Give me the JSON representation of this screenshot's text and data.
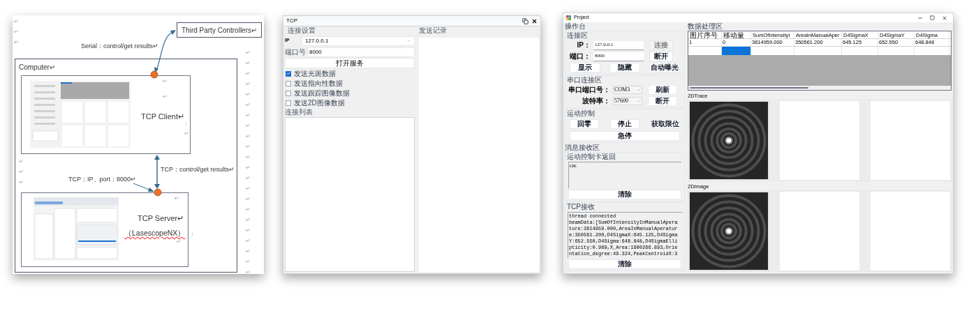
{
  "diagram": {
    "third_party": "Third Party Controllers↵",
    "serial_label": "Serial：control/get results↵",
    "computer_label": "Computer↵",
    "client_label": "TCP Client↵",
    "tcp_results_label": "TCP：control/get results↵",
    "tcp_port_label": "TCP：IP、port：8000↵",
    "server_label": "TCP Server↵",
    "server_name": "（LasescopeNX）",
    "server_name_mark": "↓",
    "left_marks": [
      "↵",
      "↵",
      "↵",
      "↵",
      "↵",
      "↵"
    ],
    "margin_marks": [
      "↵",
      "↵",
      "↵",
      "↵",
      "↵",
      "↵",
      "↵",
      "↵",
      "↵",
      "↵",
      "↵",
      "↵",
      "↵",
      "↵",
      "↵",
      "↵",
      "↵",
      "↵",
      "↵",
      "↵",
      "↵",
      "↵"
    ],
    "client_marks": [
      "↵",
      "↵",
      "↓",
      "↵"
    ],
    "server_marks": [
      "↵",
      "↵"
    ]
  },
  "tcp_window": {
    "title": "TCP",
    "settings_label": "连接设置",
    "ip_label": "IP",
    "ip_value": "127.0.0.1",
    "port_label": "端口号",
    "port_value": "8000",
    "open_button": "打开服务",
    "checkboxes": [
      {
        "label": "发送光斑数据",
        "checked": true
      },
      {
        "label": "发送指向性数据",
        "checked": false
      },
      {
        "label": "发送跟踪图像数据",
        "checked": false
      },
      {
        "label": "发送2D图像数据",
        "checked": false
      }
    ],
    "list_label": "连接列表",
    "log_label": "发送记录"
  },
  "project_window": {
    "title": "Project",
    "console_label": "操作台",
    "connect_group": "连接区",
    "connect_rows": [
      {
        "label": "IP：",
        "value": "127.0.0.1",
        "button": {
          "label": "连接",
          "disabled": true
        }
      },
      {
        "label": "端口：",
        "value": "8000",
        "button": {
          "label": "断开",
          "disabled": false
        }
      }
    ],
    "view_buttons": [
      "显示",
      "隐藏",
      "自动曝光"
    ],
    "serial_group": "串口连接区",
    "serial_rows": [
      {
        "label": "串口端口号：",
        "value": "COM3",
        "button": "刷新"
      },
      {
        "label": "波特率：",
        "value": "57600",
        "button": "断开"
      }
    ],
    "motion_group": "运动控制",
    "motion_buttons": [
      "回零",
      "停止",
      "获取限位"
    ],
    "stop_button": "急停",
    "message_group": "消息接收区",
    "motion_return_label": "运动控制卡返回",
    "motion_return_text": "OK",
    "clear_button_1": "清除",
    "tcp_receive_label": "TCP接收",
    "tcp_receive_lines": [
      "thread connected",
      "beamData:[SumOfIntensityInManualApera",
      "ture:3614959.000,AreaInManualAperatur",
      "e:350561.200,D4SigmaX:645.125,D4Sigma",
      "Y:652.550,D4Sigma:648.848,D4SigmaElli",
      "pticity:0.989,X_Area:1600266.893,Orie",
      "ntation_degree:49.324,PeakCentroidX:3"
    ],
    "clear_button_2": "清除",
    "data_group": "数据处理区",
    "table": {
      "columns": [
        "图片序号",
        "移动量",
        "SumOfIntensityI",
        "AreaInManualAper",
        "D4SigmaX",
        "D4SigmaY",
        "D4Sigma"
      ],
      "rows": [
        {
          "cells": [
            "1",
            "0",
            "3614959.000",
            "350561.200",
            "645.125",
            "652.550",
            "648.848"
          ]
        }
      ],
      "blank_row_cells": [
        {
          "selected": false
        },
        {
          "selected": true
        },
        {
          "selected": false
        },
        {
          "selected": false
        },
        {
          "selected": false
        },
        {
          "selected": false
        },
        {
          "selected": false
        }
      ]
    },
    "image_groups": [
      {
        "label": "2DTrace",
        "panes": [
          {
            "kind": "picture"
          },
          {
            "kind": "blank"
          },
          {
            "kind": "blank"
          }
        ]
      },
      {
        "label": "2DImage",
        "panes": [
          {
            "kind": "picture"
          },
          {
            "kind": "blank"
          },
          {
            "kind": "blank"
          }
        ]
      }
    ]
  }
}
